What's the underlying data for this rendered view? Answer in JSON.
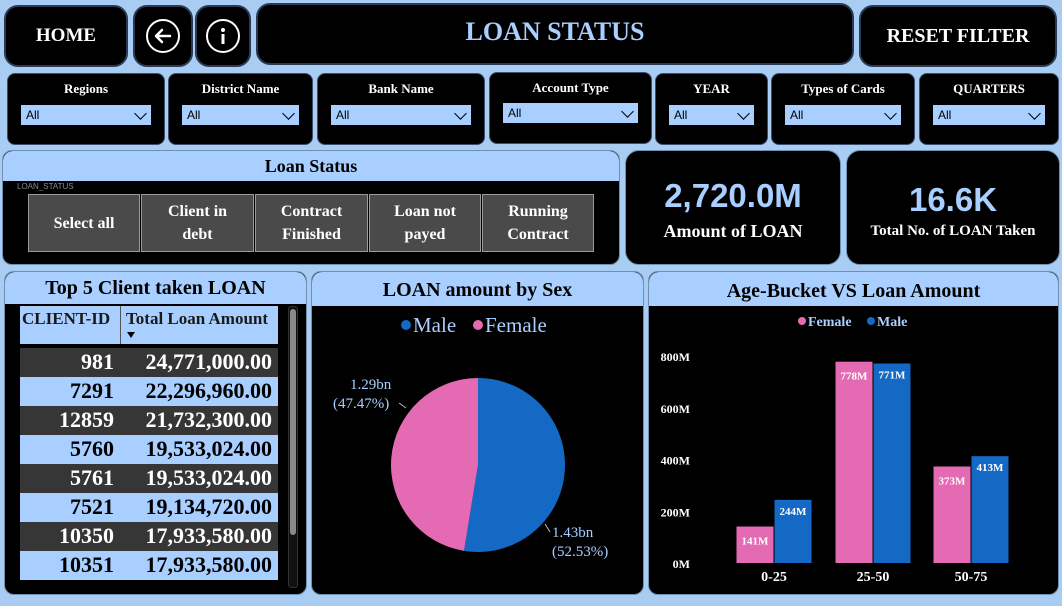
{
  "header": {
    "home_label": "HOME",
    "back_icon": "arrow-left-circle-icon",
    "info_icon": "info-circle-icon",
    "title": "LOAN STATUS",
    "reset_label": "RESET FILTER"
  },
  "filters": [
    {
      "label": "Regions",
      "value": "All"
    },
    {
      "label": "District Name",
      "value": "All"
    },
    {
      "label": "Bank Name",
      "value": "All"
    },
    {
      "label": "Account Type",
      "value": "All"
    },
    {
      "label": "YEAR",
      "value": "All"
    },
    {
      "label": "Types of Cards",
      "value": "All"
    },
    {
      "label": "QUARTERS",
      "value": "All"
    }
  ],
  "loan_status": {
    "title": "Loan Status",
    "field_label": "LOAN_STATUS",
    "options": [
      "Select all",
      "Client in debt",
      "Contract Finished",
      "Loan not payed",
      "Running Contract"
    ]
  },
  "kpis": {
    "amount_value": "2,720.0M",
    "amount_label": "Amount of LOAN",
    "count_value": "16.6K",
    "count_label": "Total No. of LOAN Taken"
  },
  "top_clients": {
    "title": "Top 5 Client taken LOAN",
    "columns": [
      "CLIENT-ID",
      "Total Loan Amount"
    ],
    "rows": [
      [
        "981",
        "24,771,000.00"
      ],
      [
        "7291",
        "22,296,960.00"
      ],
      [
        "12859",
        "21,732,300.00"
      ],
      [
        "5760",
        "19,533,024.00"
      ],
      [
        "5761",
        "19,533,024.00"
      ],
      [
        "7521",
        "19,134,720.00"
      ],
      [
        "10350",
        "17,933,580.00"
      ],
      [
        "10351",
        "17,933,580.00"
      ]
    ]
  },
  "colors": {
    "female": "#e46bb3",
    "male": "#1469c4",
    "accent": "#a8cfff"
  },
  "chart_data": [
    {
      "type": "pie",
      "title": "LOAN amount by Sex",
      "legend": [
        "Male",
        "Female"
      ],
      "slices": [
        {
          "name": "Male",
          "value": 1.43,
          "label": "1.43bn",
          "pct": "(52.53%)"
        },
        {
          "name": "Female",
          "value": 1.29,
          "label": "1.29bn",
          "pct": "(47.47%)"
        }
      ]
    },
    {
      "type": "bar",
      "title": "Age-Bucket VS Loan Amount",
      "categories": [
        "0-25",
        "25-50",
        "50-75"
      ],
      "series": [
        {
          "name": "Female",
          "values": [
            141,
            778,
            373
          ],
          "labels": [
            "141M",
            "778M",
            "373M"
          ]
        },
        {
          "name": "Male",
          "values": [
            244,
            771,
            413
          ],
          "labels": [
            "244M",
            "771M",
            "413M"
          ]
        }
      ],
      "yticks": [
        "0M",
        "200M",
        "400M",
        "600M",
        "800M"
      ],
      "ylim": [
        0,
        800
      ]
    }
  ]
}
